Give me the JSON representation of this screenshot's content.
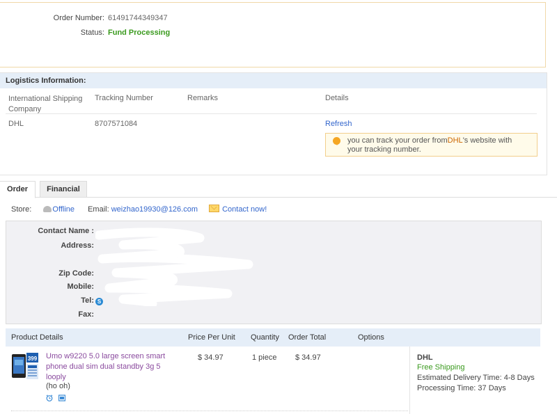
{
  "order": {
    "number_label": "Order Number:",
    "number_value": "61491744349347",
    "status_label": "Status:",
    "status_value": "Fund Processing"
  },
  "logistics": {
    "title": "Logistics Information:",
    "col_company_line1": "International Shipping",
    "col_company_line2": "Company",
    "col_tracking": "Tracking Number",
    "col_remarks": "Remarks",
    "col_details": "Details",
    "company": "DHL",
    "tracking_number": "8707571084",
    "refresh_label": "Refresh",
    "tip_prefix": "you can track your order from",
    "tip_link": "DHL",
    "tip_suffix": "'s website with your tracking number."
  },
  "tabs": {
    "order": "Order",
    "financial": "Financial"
  },
  "store": {
    "store_label": "Store:",
    "offline_label": "Offline",
    "email_label": "Email:",
    "email_value": "weizhao19930@126.com",
    "contact_label": "Contact now!"
  },
  "contact": {
    "name_label": "Contact Name :",
    "address_label": "Address:",
    "zip_label": "Zip Code:",
    "mobile_label": "Mobile:",
    "tel_label": "Tel:",
    "fax_label": "Fax:"
  },
  "products": {
    "headers": {
      "details": "Product Details",
      "price": "Price Per Unit",
      "quantity": "Quantity",
      "total": "Order Total",
      "options": "Options"
    },
    "items": [
      {
        "name": "Umo w9220 5.0 large screen smart phone dual sim dual standby 3g 5 looply",
        "sub": "(ho oh)",
        "price": "$ 34.97",
        "quantity": "1 piece",
        "total": "$ 34.97",
        "carrier": "DHL",
        "shipping": "Free Shipping",
        "delivery": "Estimated Delivery Time: 4-8 Days",
        "processing": "Processing Time: 37 Days",
        "thumb_badge": "399"
      }
    ]
  },
  "colors": {
    "status_green": "#3a9a1e",
    "link_blue": "#3366cc",
    "header_blue": "#e5eef8",
    "product_purple": "#8a4a9e"
  }
}
